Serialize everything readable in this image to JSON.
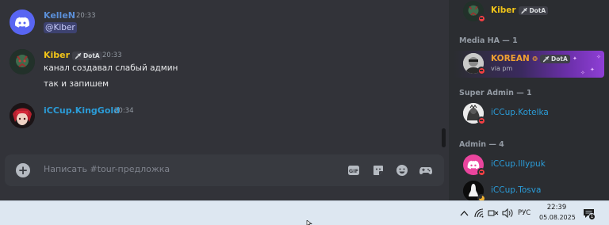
{
  "chat": {
    "messages": [
      {
        "author": "KelleN",
        "time": "20:33",
        "lines": [
          "@Kiber"
        ],
        "author_color": "#5b8fd8",
        "avatar": "discord-logo"
      },
      {
        "author": "Kiber",
        "tag": "DotA",
        "time": "20:33",
        "lines": [
          "канал создавал слабый админ",
          "так и запишем"
        ],
        "author_color": "#f0c419",
        "avatar": "guild-emblem"
      },
      {
        "author": "iCCup.KingGold",
        "time": "20:34",
        "lines": [],
        "author_color": "#2b9cd8",
        "avatar": "red-haired-character"
      }
    ],
    "composer": {
      "placeholder": "Написать #tour-предложка",
      "icons": [
        "plus-icon",
        "gif-icon",
        "sticker-icon",
        "emoji-icon",
        "game-controller-icon"
      ]
    }
  },
  "members": {
    "top_member": {
      "name": "Kiber",
      "tag": "DotA",
      "color": "#f0c419"
    },
    "groups": [
      {
        "title": "Media HA — 1",
        "members": [
          {
            "name": "KOREAN",
            "tag": "DotA",
            "activity": "via pm",
            "color": "#f0a030"
          }
        ]
      },
      {
        "title": "Super Admin — 1",
        "members": [
          {
            "name": "iCCup.Kotelka",
            "color": "#2b9cd8"
          }
        ]
      },
      {
        "title": "Admin — 4",
        "members": [
          {
            "name": "iCCup.Illypuk",
            "color": "#2b9cd8"
          },
          {
            "name": "iCCup.Tosva",
            "color": "#2b9cd8"
          }
        ]
      }
    ]
  },
  "taskbar": {
    "language": "РУС",
    "time": "22:39",
    "date": "05.08.2025",
    "notification_count": "1",
    "tray_icons": [
      "chevron-up-icon",
      "wifi-icon",
      "network-off-icon",
      "volume-icon"
    ]
  }
}
